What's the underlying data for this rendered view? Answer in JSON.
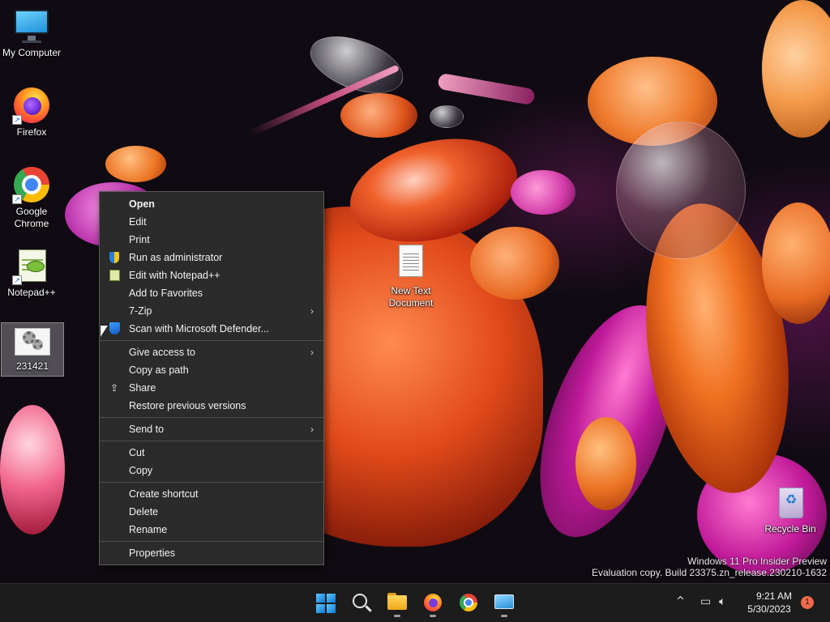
{
  "desktop": {
    "icons": [
      {
        "label": "My Computer",
        "icon": "monitor-icon"
      },
      {
        "label": "Firefox",
        "icon": "firefox-icon"
      },
      {
        "label": "Google Chrome",
        "icon": "chrome-icon"
      },
      {
        "label": "Notepad++",
        "icon": "notepadpp-icon"
      },
      {
        "label": "231421",
        "icon": "settings-file-icon"
      },
      {
        "label": "New Text Document",
        "icon": "text-document-icon"
      },
      {
        "label": "Recycle Bin",
        "icon": "recycle-bin-icon"
      }
    ]
  },
  "context_menu": {
    "groups": [
      [
        {
          "label": "Open",
          "bold": true
        },
        {
          "label": "Edit"
        },
        {
          "label": "Print"
        },
        {
          "label": "Run as administrator",
          "icon": "uac-shield-icon"
        },
        {
          "label": "Edit with Notepad++",
          "icon": "notepadpp-icon"
        },
        {
          "label": "Add to Favorites"
        },
        {
          "label": "7-Zip",
          "submenu": true
        },
        {
          "label": "Scan with Microsoft Defender...",
          "icon": "defender-shield-icon"
        }
      ],
      [
        {
          "label": "Give access to",
          "submenu": true
        },
        {
          "label": "Copy as path"
        },
        {
          "label": "Share",
          "icon": "share-icon"
        },
        {
          "label": "Restore previous versions"
        }
      ],
      [
        {
          "label": "Send to",
          "submenu": true
        }
      ],
      [
        {
          "label": "Cut"
        },
        {
          "label": "Copy"
        }
      ],
      [
        {
          "label": "Create shortcut"
        },
        {
          "label": "Delete"
        },
        {
          "label": "Rename"
        }
      ],
      [
        {
          "label": "Properties"
        }
      ]
    ],
    "submenu_glyph": "›"
  },
  "watermark": {
    "line1": "Windows 11 Pro Insider Preview",
    "line2": "Evaluation copy. Build 23375.zn_release.230210-1632"
  },
  "taskbar": {
    "apps": [
      "start-icon",
      "search-icon",
      "file-explorer-icon",
      "firefox-icon",
      "chrome-icon",
      "control-panel-icon"
    ],
    "tray": {
      "overflow_glyph": "^",
      "time": "9:21 AM",
      "date": "5/30/2023",
      "notification_count": "1"
    }
  },
  "colors": {
    "menu_bg": "#2b2b2b",
    "taskbar_bg": "#1c1c1c",
    "accent": "#0a78d8",
    "notification_badge": "#f0684a"
  }
}
